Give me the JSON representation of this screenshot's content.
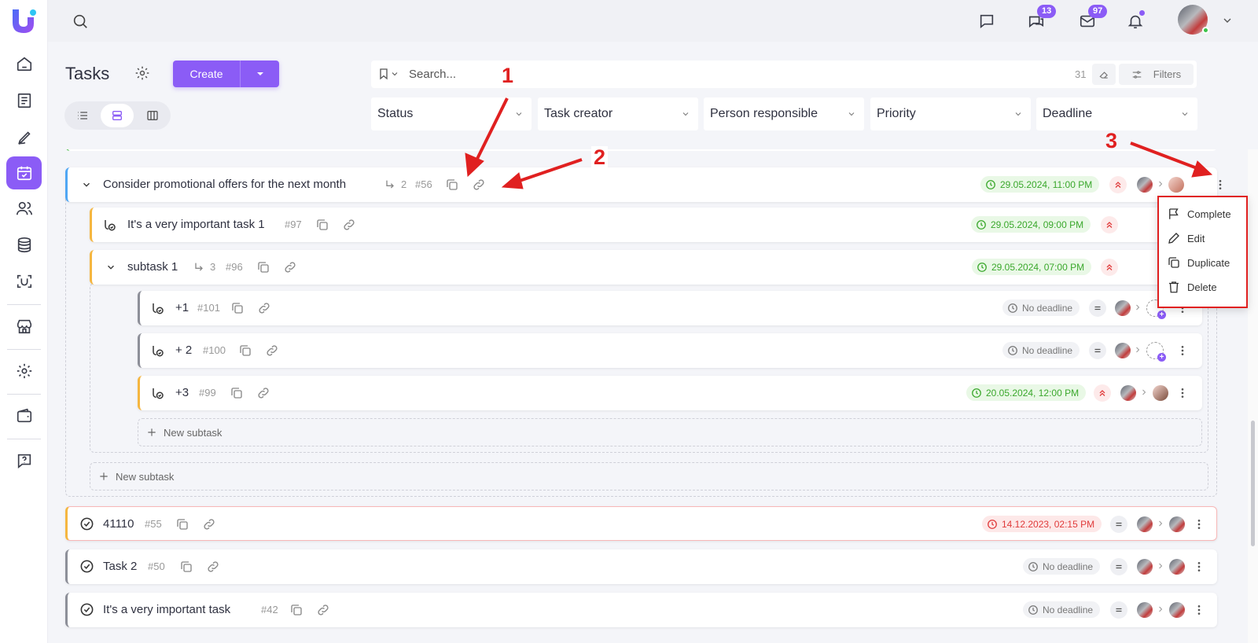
{
  "sidebar": {
    "logo": "U",
    "items": [
      {
        "name": "home-icon",
        "active": false
      },
      {
        "name": "document-icon",
        "active": false
      },
      {
        "name": "pen-icon",
        "active": false
      },
      {
        "name": "calendar-check-icon",
        "active": true
      },
      {
        "name": "users-icon",
        "active": false
      },
      {
        "name": "database-icon",
        "active": false
      },
      {
        "name": "scan-icon",
        "active": false
      },
      {
        "name": "store-icon",
        "active": false
      },
      {
        "name": "gear-icon",
        "active": false
      },
      {
        "name": "wallet-icon",
        "active": false
      },
      {
        "name": "help-icon",
        "active": false
      }
    ]
  },
  "topbar": {
    "chat_badge": "13",
    "mail_badge": "97"
  },
  "header": {
    "title": "Tasks",
    "create_label": "Create",
    "search_placeholder": "Search...",
    "count": "31",
    "filters_label": "Filters",
    "filter_selects": [
      "Status",
      "Task creator",
      "Person responsible",
      "Priority",
      "Deadline"
    ]
  },
  "tasks": {
    "parent": {
      "title": "Consider promotional offers for the next month",
      "subtask_count": "2",
      "id": "#56",
      "deadline": "29.05.2024, 11:00 PM"
    },
    "sub1": {
      "title": "It's a very important task 1",
      "id": "#97",
      "deadline": "29.05.2024, 09:00 PM"
    },
    "sub2": {
      "title": "subtask 1",
      "subtask_count": "3",
      "id": "#96",
      "deadline": "29.05.2024, 07:00 PM"
    },
    "sub2a": {
      "title": "+1",
      "id": "#101",
      "deadline": "No deadline"
    },
    "sub2b": {
      "title": "+ 2",
      "id": "#100",
      "deadline": "No deadline"
    },
    "sub2c": {
      "title": "+3",
      "id": "#99",
      "deadline": "20.05.2024, 12:00 PM"
    },
    "new_subtask_label": "New subtask",
    "t41110": {
      "title": "41110",
      "id": "#55",
      "deadline": "14.12.2023, 02:15 PM"
    },
    "task2": {
      "title": "Task 2",
      "id": "#50",
      "deadline": "No deadline"
    },
    "important": {
      "title": "It's a very important task",
      "id": "#42",
      "deadline": "No deadline"
    }
  },
  "context_menu": {
    "complete": "Complete",
    "edit": "Edit",
    "duplicate": "Duplicate",
    "delete": "Delete"
  },
  "annotations": {
    "a1": "1",
    "a2": "2",
    "a3": "3"
  },
  "colors": {
    "accent": "#8b5cf6",
    "annotation": "#e02020",
    "deadline_green": "#3aa82c",
    "deadline_red": "#e03a3a"
  }
}
